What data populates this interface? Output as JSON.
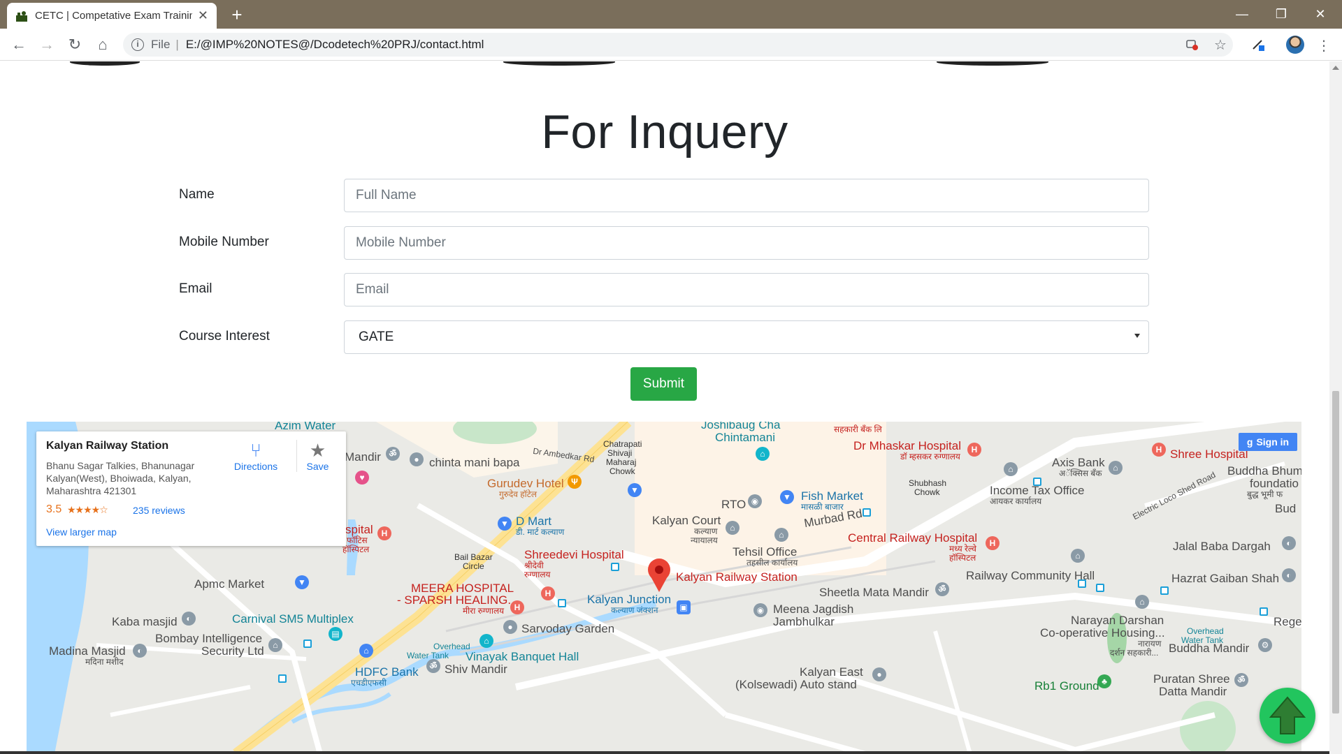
{
  "browser": {
    "tab_title": "CETC | Competative Exam Trainin",
    "scheme": "File",
    "url": "E:/@IMP%20NOTES@/Dcodetech%20PRJ/contact.html"
  },
  "page": {
    "heading": "For Inquery",
    "form": {
      "name_label": "Name",
      "name_placeholder": "Full Name",
      "mobile_label": "Mobile Number",
      "mobile_placeholder": "Mobile Number",
      "email_label": "Email",
      "email_placeholder": "Email",
      "course_label": "Course Interest",
      "course_selected": "GATE",
      "submit_label": "Submit"
    }
  },
  "map": {
    "card": {
      "place": "Kalyan Railway Station",
      "address": "Bhanu Sagar Talkies, Bhanunagar Kalyan(West), Bhoiwada, Kalyan, Maharashtra 421301",
      "rating": "3.5",
      "stars": "★★★★☆",
      "reviews": "235 reviews",
      "larger_map": "View larger map",
      "directions": "Directions",
      "save": "Save"
    },
    "signin": "Sign in",
    "labels": {
      "azim": "Azim Water",
      "mandir": "Mandir",
      "chinta": "chinta mani bapa",
      "chatrapati": "Chatrapati",
      "shivaji": "Shivaji",
      "maharaj": "Maharaj",
      "chowk": "Chowk",
      "ambedkar": "Dr Ambedkar Rd",
      "joshibaug1": "Joshibaug Cha",
      "joshibaug2": "Chintamani",
      "sahkari": "सहकारी बँक लि",
      "mhaskar": "Dr Mhaskar Hospital",
      "mhaskar_mr": "डॉ म्हसकर रुग्णालय",
      "shree": "Shree Hospital",
      "buddha1": "Buddha Bhum",
      "buddha2": "foundatio",
      "buddha3": "बुद्ध भूमी फ",
      "bud": "Bud",
      "gurudev": "Gurudev Hotel",
      "gurudev_mr": "गुरुदेव हॉटेल",
      "rto": "RTO",
      "fish": "Fish Market",
      "fish_mr": "मासळी बाजार",
      "shubhash1": "Shubhash",
      "shubhash2": "Chowk",
      "axis": "Axis Bank",
      "axis_mr": "अॅक्सिस बँक",
      "incometax": "Income Tax Office",
      "incometax_mr": "आयकर कार्यालय",
      "electric": "Electric Loco Shed Road",
      "dmart": "D Mart",
      "dmart_mr": "डी. मार्ट कल्याण",
      "kalyancourt": "Kalyan Court",
      "kalyancourt_mr1": "कल्याण",
      "kalyancourt_mr2": "न्यायालय",
      "murbad": "Murbad Rd",
      "spital": "spital",
      "spital_mr1": "फॉटिस",
      "spital_mr2": "हॉस्पिटल",
      "bailbazar1": "Bail Bazar",
      "bailbazar2": "Circle",
      "shreedevi": "Shreedevi Hospital",
      "shreedevi_mr1": "श्रीदेवी",
      "shreedevi_mr2": "रुग्णालय",
      "tehsil": "Tehsil Office",
      "tehsil_mr": "तहसील कार्यालय",
      "central": "Central Railway Hospital",
      "central_mr1": "मध्य रेल्वे",
      "central_mr2": "हॉस्पिटल",
      "jalal": "Jalal Baba Dargah",
      "apmc": "Apmc Market",
      "meera1": "MEERA HOSPITAL",
      "meera2": "- SPARSH HEALING...",
      "meera_mr": "मीरा रुग्णालय",
      "kalyanstation": "Kalyan Railway Station",
      "railwayhall": "Railway Community Hall",
      "hazrat": "Hazrat Gaiban Shah",
      "sheetla": "Sheetla Mata Mandir",
      "kalyanjn": "Kalyan Junction",
      "kalyanjn_mr": "कल्याण जंक्शन",
      "meena1": "Meena Jagdish",
      "meena2": "Jambhulkar",
      "narayan1": "Narayan Darshan",
      "narayan2": "Co-operative Housing...",
      "narayan3": "नारायण",
      "narayan4": "दर्शन सहकारी...",
      "kaba": "Kaba masjid",
      "carnival": "Carnival SM5 Multiplex",
      "sarvoday": "Sarvoday Garden",
      "overhead1": "Overhead",
      "overhead2": "Water Tank",
      "overheadR1": "Overhead",
      "overheadR2": "Water Tank",
      "regen": "Regen",
      "madina": "Madina Masjid",
      "madina_mr": "मदिना मशीद",
      "bombay1": "Bombay Intelligence",
      "bombay2": "Security Ltd",
      "vinayak": "Vinayak Banquet Hall",
      "buddhamandir": "Buddha Mandir",
      "hdfc": "HDFC Bank",
      "hdfc_mr": "एचडीएफसी",
      "shiv": "Shiv Mandir",
      "kalyaneast1": "Kalyan East",
      "kalyaneast2": "(Kolsewadi) Auto stand",
      "rb1": "Rb1 Ground",
      "puratan1": "Puratan Shree",
      "puratan2": "Datta Mandir"
    }
  },
  "colors": {
    "submit": "#28a745",
    "titlebar": "#7a6e5b",
    "scroll_top_button": "#22c55e"
  }
}
